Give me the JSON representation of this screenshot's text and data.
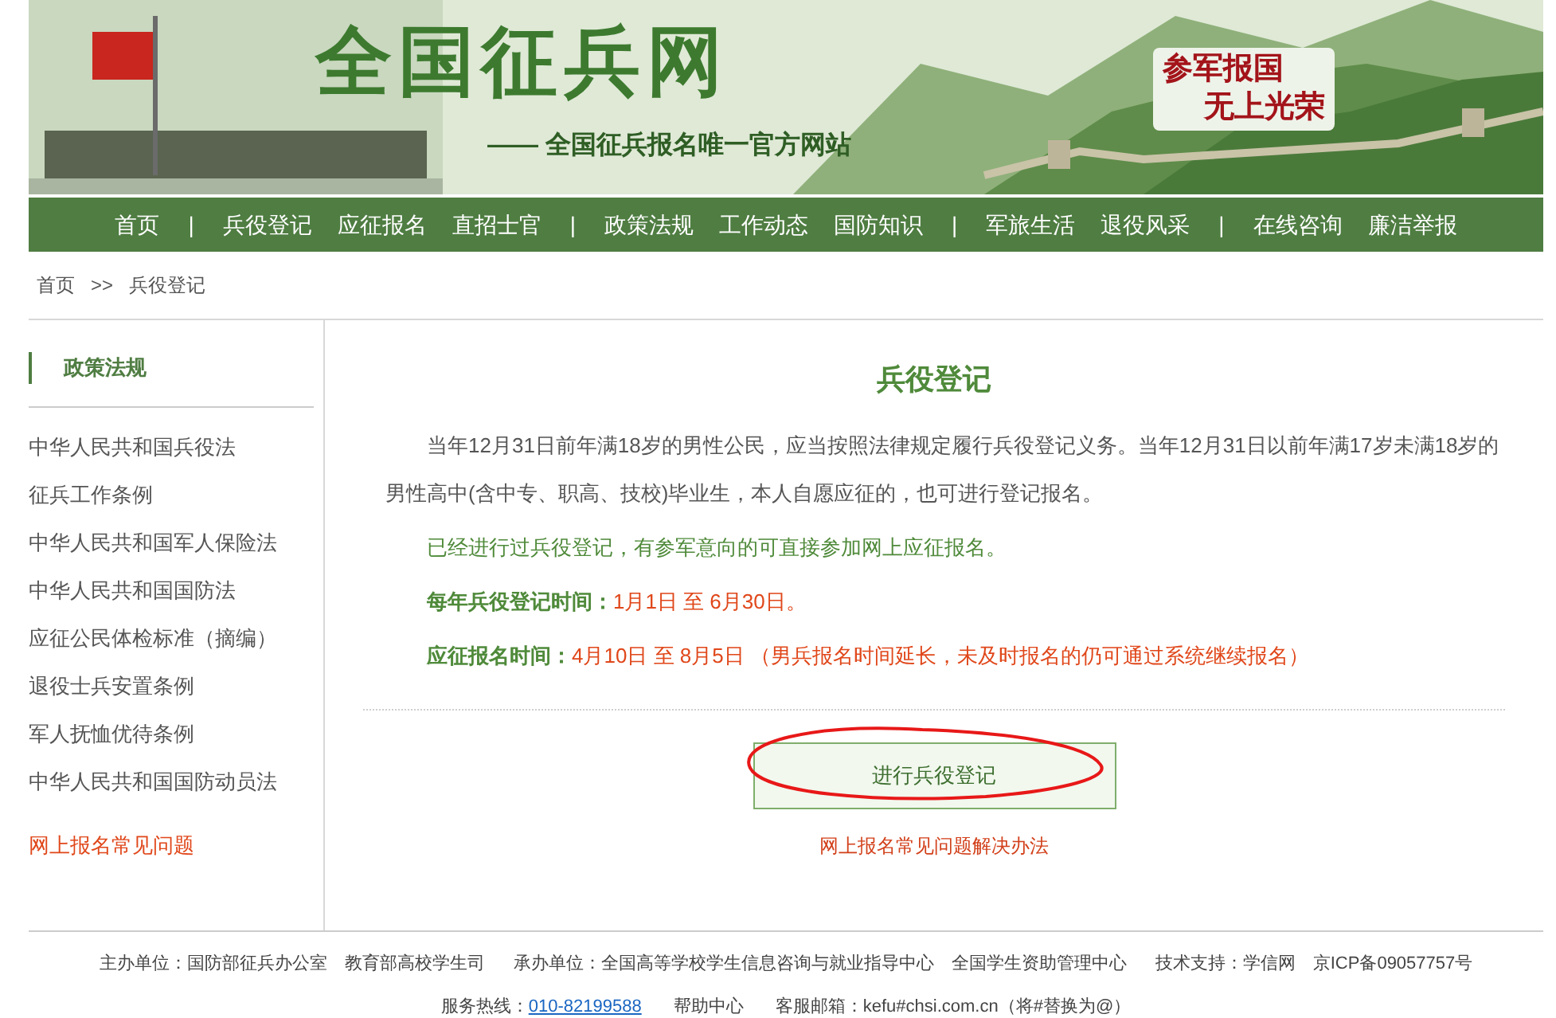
{
  "banner": {
    "site_name": "全国征兵网",
    "tagline": "—— 全国征兵报名唯一官方网站",
    "slogan_lines": [
      "参军报国",
      "无上光荣"
    ]
  },
  "nav": [
    {
      "kind": "link",
      "label": "首页"
    },
    {
      "kind": "separator",
      "label": "|"
    },
    {
      "kind": "link",
      "label": "兵役登记"
    },
    {
      "kind": "link",
      "label": "应征报名"
    },
    {
      "kind": "link",
      "label": "直招士官"
    },
    {
      "kind": "separator",
      "label": "|"
    },
    {
      "kind": "link",
      "label": "政策法规"
    },
    {
      "kind": "link",
      "label": "工作动态"
    },
    {
      "kind": "link",
      "label": "国防知识"
    },
    {
      "kind": "separator",
      "label": "|"
    },
    {
      "kind": "link",
      "label": "军旅生活"
    },
    {
      "kind": "link",
      "label": "退役风采"
    },
    {
      "kind": "separator",
      "label": "|"
    },
    {
      "kind": "link",
      "label": "在线咨询"
    },
    {
      "kind": "link",
      "label": "廉洁举报"
    }
  ],
  "breadcrumb": [
    "首页",
    ">>",
    "兵役登记"
  ],
  "sidebar": {
    "heading": "政策法规",
    "items": [
      {
        "label": "中华人民共和国兵役法",
        "kind": "link"
      },
      {
        "label": "征兵工作条例",
        "kind": "link"
      },
      {
        "label": "中华人民共和国军人保险法",
        "kind": "link"
      },
      {
        "label": "中华人民共和国国防法",
        "kind": "link"
      },
      {
        "label": "应征公民体检标准（摘编）",
        "kind": "link"
      },
      {
        "label": "退役士兵安置条例",
        "kind": "link"
      },
      {
        "label": "军人抚恤优待条例",
        "kind": "link"
      },
      {
        "label": "中华人民共和国国防动员法",
        "kind": "link"
      },
      {
        "label": "网上报名常见问题",
        "kind": "highlight"
      }
    ]
  },
  "main": {
    "title": "兵役登记",
    "paragraphs": [
      {
        "kind": "plain",
        "text": "当年12月31日前年满18岁的男性公民，应当按照法律规定履行兵役登记义务。当年12月31日以前年满17岁未满18岁的男性高中(含中专、职高、技校)毕业生，本人自愿应征的，也可进行登记报名。"
      },
      {
        "kind": "notice",
        "text": "已经进行过兵役登记，有参军意向的可直接参加网上应征报名。"
      },
      {
        "kind": "schedule",
        "label": "每年兵役登记时间：",
        "value": "1月1日 至 6月30日。"
      },
      {
        "kind": "schedule",
        "label": "应征报名时间：",
        "value": "4月10日 至 8月5日 （男兵报名时间延长，未及时报名的仍可通过系统继续报名）"
      }
    ],
    "button": "进行兵役登记",
    "help_link": "网上报名常见问题解决办法"
  },
  "footer": {
    "line_1": [
      "主办单位：国防部征兵办公室　教育部高校学生司",
      "承办单位：全国高等学校学生信息咨询与就业指导中心　全国学生资助管理中心",
      "技术支持：学信网　京ICP备09057757号"
    ],
    "line_2": [
      {
        "kind": "text",
        "text": "服务热线："
      },
      {
        "kind": "link",
        "text": "010-82199588"
      },
      {
        "kind": "text",
        "text": "帮助中心"
      },
      {
        "kind": "text",
        "text": "客服邮箱：kefu#chsi.com.cn（将#替换为@）"
      }
    ]
  }
}
